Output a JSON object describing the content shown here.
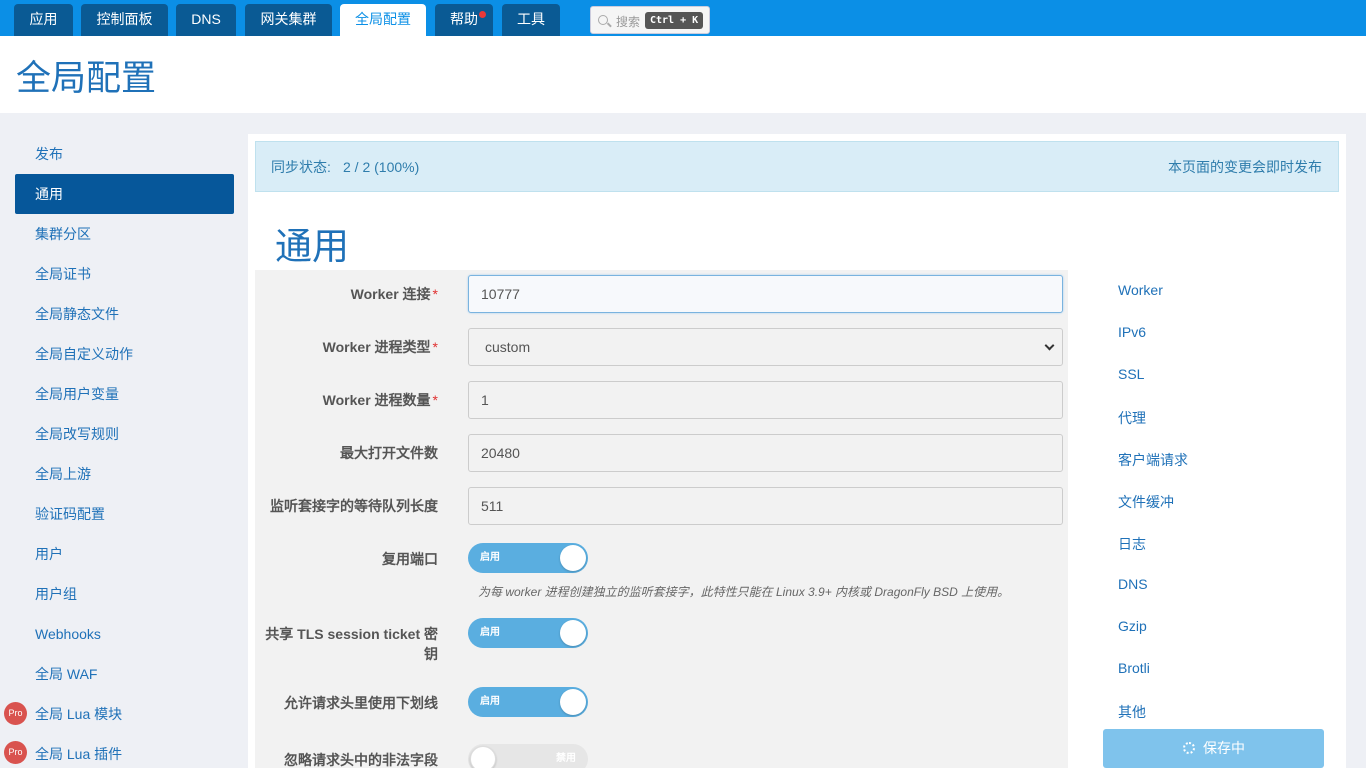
{
  "topnav": {
    "tabs": [
      {
        "label": "应用"
      },
      {
        "label": "控制面板"
      },
      {
        "label": "DNS"
      },
      {
        "label": "网关集群"
      },
      {
        "label": "全局配置"
      },
      {
        "label": "帮助"
      },
      {
        "label": "工具"
      }
    ],
    "active_tab": "全局配置",
    "search": {
      "label": "搜索",
      "shortcut": "Ctrl + K"
    }
  },
  "header": {
    "title": "全局配置"
  },
  "sidebar": {
    "active_item": "通用",
    "items": [
      {
        "label": "发布"
      },
      {
        "label": "通用"
      },
      {
        "label": "集群分区"
      },
      {
        "label": "全局证书"
      },
      {
        "label": "全局静态文件"
      },
      {
        "label": "全局自定义动作"
      },
      {
        "label": "全局用户变量"
      },
      {
        "label": "全局改写规则"
      },
      {
        "label": "全局上游"
      },
      {
        "label": "验证码配置"
      },
      {
        "label": "用户"
      },
      {
        "label": "用户组"
      },
      {
        "label": "Webhooks"
      },
      {
        "label": "全局 WAF"
      },
      {
        "label": "全局 Lua 模块",
        "badge": "Pro"
      },
      {
        "label": "全局 Lua 插件",
        "badge": "Pro"
      }
    ]
  },
  "sync": {
    "label": "同步状态:",
    "value": "2 / 2 (100%)",
    "note": "本页面的变更会即时发布"
  },
  "section": {
    "title": "通用"
  },
  "form": {
    "worker_connections": {
      "label": "Worker 连接",
      "required": "*",
      "value": "10777"
    },
    "worker_process_type": {
      "label": "Worker 进程类型",
      "required": "*",
      "value": "custom"
    },
    "worker_process_count": {
      "label": "Worker 进程数量",
      "required": "*",
      "value": "1"
    },
    "max_open_files": {
      "label": "最大打开文件数",
      "value": "20480"
    },
    "listen_backlog": {
      "label": "监听套接字的等待队列长度",
      "value": "511"
    },
    "reuse_port": {
      "label": "复用端口",
      "state": "启用",
      "hint": "为每 worker 进程创建独立的监听套接字，此特性只能在 Linux 3.9+ 内核或 DragonFly BSD 上使用。"
    },
    "share_tls_ticket": {
      "label_line1": "共享 TLS session ticket 密",
      "label_line2": "钥",
      "state": "启用"
    },
    "underscores_in_headers": {
      "label": "允许请求头里使用下划线",
      "state": "启用"
    },
    "ignore_invalid_headers": {
      "label": "忽略请求头中的非法字段",
      "state": "禁用"
    }
  },
  "anchors": [
    {
      "label": "Worker"
    },
    {
      "label": "IPv6"
    },
    {
      "label": "SSL"
    },
    {
      "label": "代理"
    },
    {
      "label": "客户端请求"
    },
    {
      "label": "文件缓冲"
    },
    {
      "label": "日志"
    },
    {
      "label": "DNS"
    },
    {
      "label": "Gzip"
    },
    {
      "label": "Brotli"
    },
    {
      "label": "其他"
    }
  ],
  "save_button": {
    "label": "保存中"
  },
  "colors": {
    "primary": "#0b8fe6",
    "accent": "#1f71b8",
    "active_nav": "#06579a",
    "pro_badge": "#d9534f",
    "toggle_on": "#5aaee0"
  }
}
